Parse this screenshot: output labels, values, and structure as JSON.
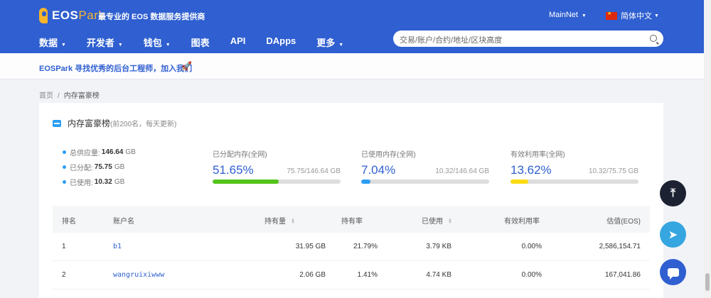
{
  "header": {
    "logo_eos": "EOS",
    "logo_park": "Park",
    "slogan": "最专业的 EOS 数据服务提供商",
    "network": "MainNet",
    "language": "简体中文",
    "nav": [
      "数据",
      "开发者",
      "钱包",
      "图表",
      "API",
      "DApps",
      "更多"
    ],
    "search_placeholder": "交易/账户/合约/地址/区块高度"
  },
  "announcement": "EOSPark 寻找优秀的后台工程师，加入我们",
  "breadcrumb": {
    "home": "首页",
    "sep": "/",
    "current": "内存富豪榜"
  },
  "card": {
    "title": "内存富豪榜",
    "subtitle": "(前200名，每天更新)",
    "totals": [
      {
        "label": "总供应量:",
        "value": "146.64",
        "unit": "GB"
      },
      {
        "label": "已分配:",
        "value": "75.75",
        "unit": "GB"
      },
      {
        "label": "已使用:",
        "value": "10.32",
        "unit": "GB"
      }
    ],
    "stats": [
      {
        "label": "已分配内存(全网)",
        "pct": "51.65%",
        "ratio": "75.75/146.64 GB",
        "fill": 0.5165,
        "color": "#52c41a"
      },
      {
        "label": "已使用内存(全网)",
        "pct": "7.04%",
        "ratio": "10.32/146.64 GB",
        "fill": 0.0704,
        "color": "#2a9df4"
      },
      {
        "label": "有效利用率(全网)",
        "pct": "13.62%",
        "ratio": "10.32/75.75 GB",
        "fill": 0.1362,
        "color": "#fadb14"
      }
    ]
  },
  "table": {
    "headers": [
      "排名",
      "账户名",
      "持有量",
      "持有率",
      "已使用",
      "有效利用率",
      "估值(EOS)"
    ],
    "rows": [
      [
        "1",
        "b1",
        "31.95 GB",
        "21.79%",
        "3.79 KB",
        "0.00%",
        "2,586,154.71"
      ],
      [
        "2",
        "wangruixiwww",
        "2.06 GB",
        "1.41%",
        "4.74 KB",
        "0.00%",
        "167,041.86"
      ]
    ]
  },
  "icons": {
    "search": "search-icon",
    "rocket": "rocket-icon",
    "ranking": "ranking-icon",
    "back_to_top": "arrow-up-icon",
    "telegram": "telegram-icon",
    "chat": "chat-icon"
  }
}
